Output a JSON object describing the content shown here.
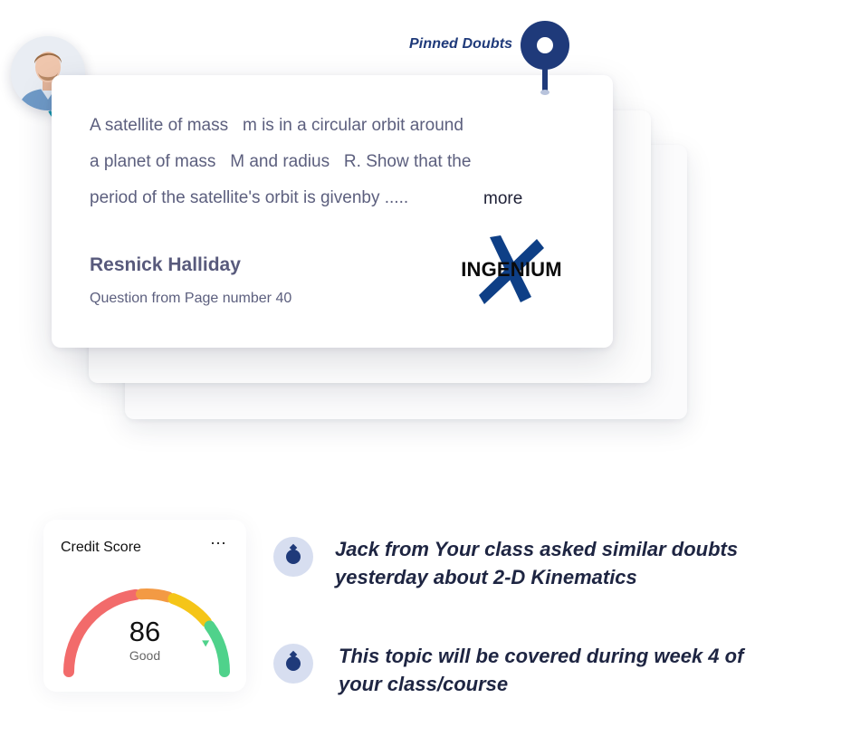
{
  "pinned": {
    "label": "Pinned Doubts"
  },
  "doubt_card": {
    "question_lines": [
      "A satellite of mass   m is in a circular orbit around",
      "a planet of mass   M and radius   R. Show that the",
      "period of the satellite's orbit is givenby ....."
    ],
    "more_label": "more",
    "author": "Resnick Halliday",
    "page_ref": "Question from Page number 40",
    "brand_logo_text": "INGENIUM"
  },
  "credit_score": {
    "title": "Credit Score",
    "menu_icon": "more-dots-icon",
    "score": "86",
    "rating": "Good",
    "score_fraction": 0.86,
    "segment_colors": [
      "#f26b6b",
      "#f39a44",
      "#f5c518",
      "#4fd28b"
    ]
  },
  "insights": [
    {
      "icon": "pin-icon",
      "text_lines": [
        "Jack from Your class asked similar doubts",
        "yesterday about 2-D Kinematics"
      ]
    },
    {
      "icon": "pin-icon",
      "text_lines": [
        "This topic will be covered during week 4 of",
        "your class/course"
      ]
    }
  ],
  "colors": {
    "accent": "#1f3a7a",
    "text_muted": "#5c5f7e",
    "text_dark": "#1e2542"
  }
}
